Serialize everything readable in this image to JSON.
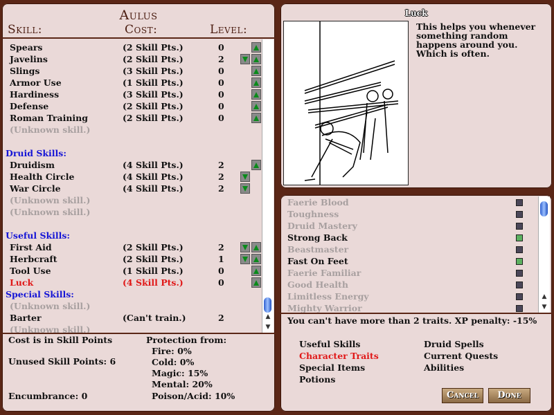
{
  "character": {
    "name": "Aulus"
  },
  "headers": {
    "skill": "Skill:",
    "cost": "Cost:",
    "level": "Level:"
  },
  "skills": [
    {
      "type": "skill",
      "name": "Spears",
      "cost": "(2 Skill Pts.)",
      "level": "0",
      "up": true,
      "down": false
    },
    {
      "type": "skill",
      "name": "Javelins",
      "cost": "(2 Skill Pts.)",
      "level": "2",
      "up": true,
      "down": true
    },
    {
      "type": "skill",
      "name": "Slings",
      "cost": "(3 Skill Pts.)",
      "level": "0",
      "up": true,
      "down": false
    },
    {
      "type": "skill",
      "name": "Armor Use",
      "cost": "(1 Skill Pts.)",
      "level": "0",
      "up": true,
      "down": false
    },
    {
      "type": "skill",
      "name": "Hardiness",
      "cost": "(3 Skill Pts.)",
      "level": "0",
      "up": true,
      "down": false
    },
    {
      "type": "skill",
      "name": "Defense",
      "cost": "(2 Skill Pts.)",
      "level": "0",
      "up": true,
      "down": false
    },
    {
      "type": "skill",
      "name": "Roman Training",
      "cost": "(2 Skill Pts.)",
      "level": "0",
      "up": true,
      "down": false
    },
    {
      "type": "unknown",
      "name": "(Unknown skill.)"
    },
    {
      "type": "blank"
    },
    {
      "type": "section",
      "name": "Druid Skills:"
    },
    {
      "type": "skill",
      "name": "Druidism",
      "cost": "(4 Skill Pts.)",
      "level": "2",
      "up": true,
      "down": false
    },
    {
      "type": "skill",
      "name": "Health Circle",
      "cost": "(4 Skill Pts.)",
      "level": "2",
      "up": false,
      "down": true
    },
    {
      "type": "skill",
      "name": "War Circle",
      "cost": "(4 Skill Pts.)",
      "level": "2",
      "up": false,
      "down": true
    },
    {
      "type": "unknown",
      "name": "(Unknown skill.)"
    },
    {
      "type": "unknown",
      "name": "(Unknown skill.)"
    },
    {
      "type": "blank"
    },
    {
      "type": "section",
      "name": "Useful Skills:"
    },
    {
      "type": "skill",
      "name": "First Aid",
      "cost": "(2 Skill Pts.)",
      "level": "2",
      "up": true,
      "down": true
    },
    {
      "type": "skill",
      "name": "Herbcraft",
      "cost": "(2 Skill Pts.)",
      "level": "1",
      "up": true,
      "down": true
    },
    {
      "type": "skill",
      "name": "Tool Use",
      "cost": "(1 Skill Pts.)",
      "level": "0",
      "up": true,
      "down": false
    },
    {
      "type": "skill",
      "name": "Luck",
      "cost": "(4 Skill Pts.)",
      "level": "0",
      "up": true,
      "down": false,
      "selected": true
    },
    {
      "type": "section",
      "name": "Special Skills:"
    },
    {
      "type": "unknown",
      "name": "(Unknown skill.)"
    },
    {
      "type": "skill",
      "name": "Barter",
      "cost": "(Can't train.)",
      "level": "2",
      "up": false,
      "down": false
    },
    {
      "type": "unknown",
      "name": "(Unknown skill.)"
    }
  ],
  "summary": {
    "cost_note": "Cost is in Skill Points",
    "unused": "Unused Skill Points: 6",
    "encumbrance": "Encumbrance: 0",
    "protection_title": "Protection from:",
    "protection": [
      "Fire: 0%",
      "Cold: 0%",
      "Magic: 15%",
      "Mental: 20%",
      "Poison/Acid: 10%"
    ]
  },
  "detail": {
    "title": "Luck",
    "description": "This helps you whenever something random happens around you. Which is often."
  },
  "traits": [
    {
      "name": "Faerie Blood",
      "active": false
    },
    {
      "name": "Toughness",
      "active": false
    },
    {
      "name": "Druid Mastery",
      "active": false
    },
    {
      "name": "Strong Back",
      "active": true
    },
    {
      "name": "Beastmaster",
      "active": false
    },
    {
      "name": "Fast On Feet",
      "active": true
    },
    {
      "name": "Faerie Familiar",
      "active": false
    },
    {
      "name": "Good Health",
      "active": false
    },
    {
      "name": "Limitless Energy",
      "active": false
    },
    {
      "name": "Mighty Warrior",
      "active": false
    }
  ],
  "traits_note": "You can't have more than 2 traits. XP penalty: -15%",
  "tabs": [
    {
      "label": "Useful Skills",
      "active": false
    },
    {
      "label": "Character Traits",
      "active": true
    },
    {
      "label": "Special Items",
      "active": false
    },
    {
      "label": "Potions",
      "active": false
    },
    {
      "label": "Druid Spells",
      "active": false
    },
    {
      "label": "Current Quests",
      "active": false
    },
    {
      "label": "Abilities",
      "active": false
    }
  ],
  "buttons": {
    "cancel": "Cancel",
    "done": "Done"
  },
  "colors": {
    "section": "#1515d6",
    "selected": "#e01818",
    "unknown": "#a8a0a0",
    "active_checkbox": "#5cb060"
  }
}
